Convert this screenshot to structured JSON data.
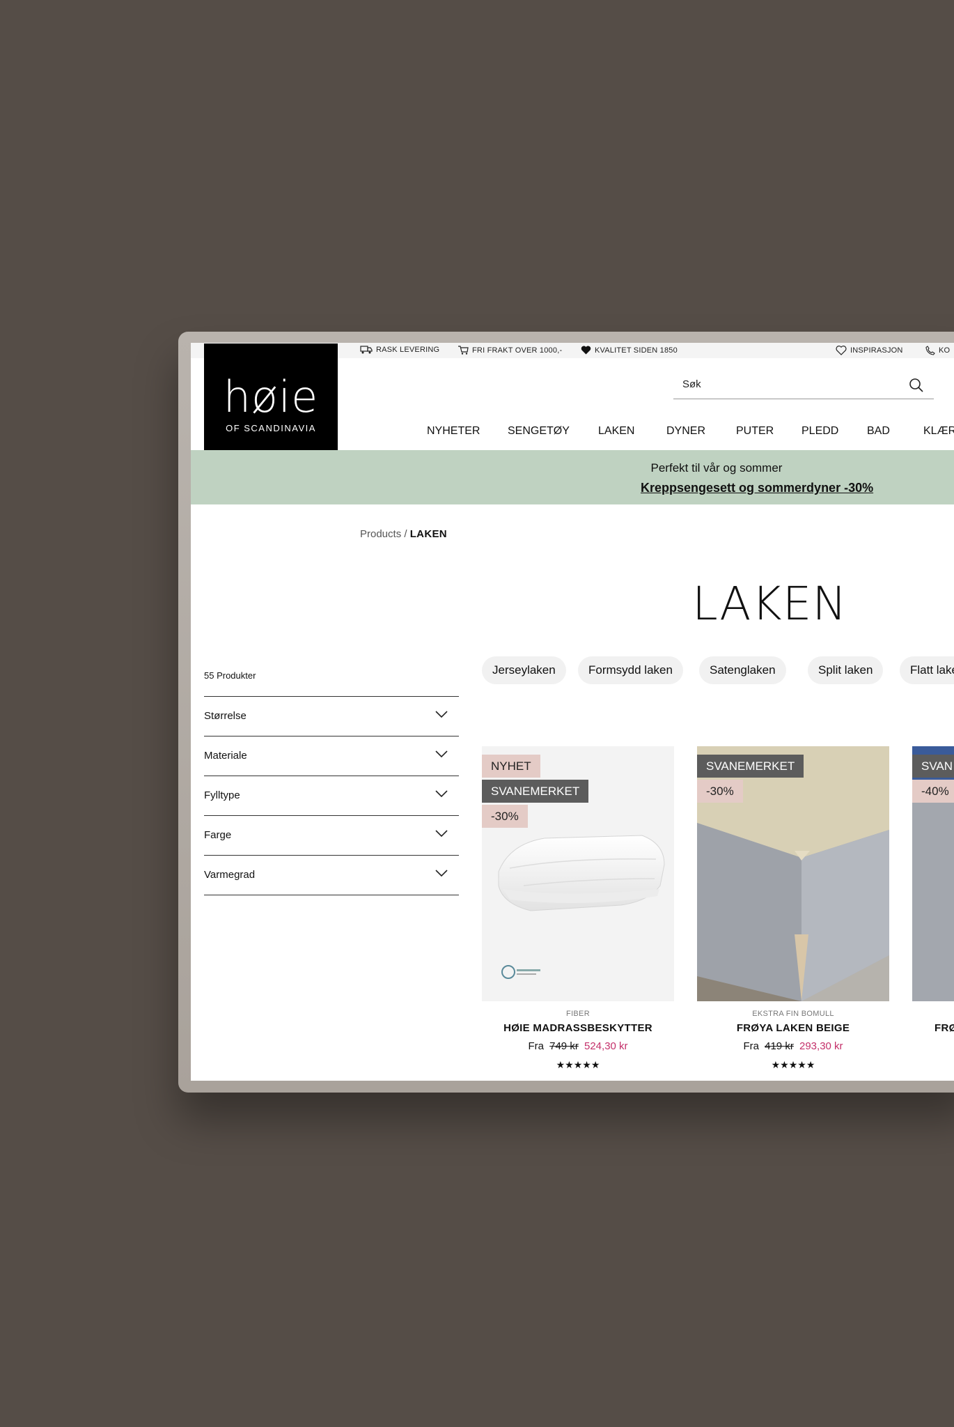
{
  "utility_bar": {
    "delivery": "RASK LEVERING",
    "shipping": "FRI FRAKT OVER 1000,-",
    "quality": "KVALITET SIDEN 1850",
    "inspiration": "INSPIRASJON",
    "contact": "KO"
  },
  "logo": {
    "main": "høie",
    "sub": "OF SCANDINAVIA"
  },
  "search": {
    "placeholder": "Søk"
  },
  "nav": [
    "NYHETER",
    "SENGETØY",
    "LAKEN",
    "DYNER",
    "PUTER",
    "PLEDD",
    "BAD",
    "KLÆR"
  ],
  "promo": {
    "line1": "Perfekt til vår og sommer",
    "link": "Kreppsengesett og sommerdyner -30%"
  },
  "breadcrumb": {
    "parent": "Products",
    "separator": "/",
    "current": "LAKEN"
  },
  "page_title": "LAKEN",
  "product_count": "55 Produkter",
  "filters": [
    "Størrelse",
    "Materiale",
    "Fylltype",
    "Farge",
    "Varmegrad"
  ],
  "categories": [
    "Jerseylaken",
    "Formsydd laken",
    "Satenglaken",
    "Split laken",
    "Flatt laken"
  ],
  "products": [
    {
      "badges": [
        "NYHET",
        "SVANEMERKET",
        "-30%"
      ],
      "category": "FIBER",
      "name": "HØIE MADRASSBESKYTTER",
      "from": "Fra",
      "old_price": "749 kr",
      "price": "524,30 kr",
      "rating": 4.5,
      "stars": "★★★★★"
    },
    {
      "badges": [
        "SVANEMERKET",
        "-30%"
      ],
      "category": "EKSTRA FIN BOMULL",
      "name": "FRØYA LAKEN BEIGE",
      "from": "Fra",
      "old_price": "419 kr",
      "price": "293,30 kr",
      "rating": 4.5,
      "stars": "★★★★★"
    },
    {
      "badges": [
        "SVAN",
        "-40%"
      ],
      "name": "FRØ"
    }
  ],
  "colors": {
    "background": "#554d47",
    "promo_bar": "#bfd2c1",
    "sale_price": "#c4306a",
    "badge_pink": "#e4cbc6",
    "badge_gray": "#5c5c5c"
  },
  "icons": [
    "truck-icon",
    "cart-icon",
    "heart-icon",
    "heart-outline-icon",
    "phone-icon",
    "search-icon",
    "chevron-down-icon"
  ]
}
